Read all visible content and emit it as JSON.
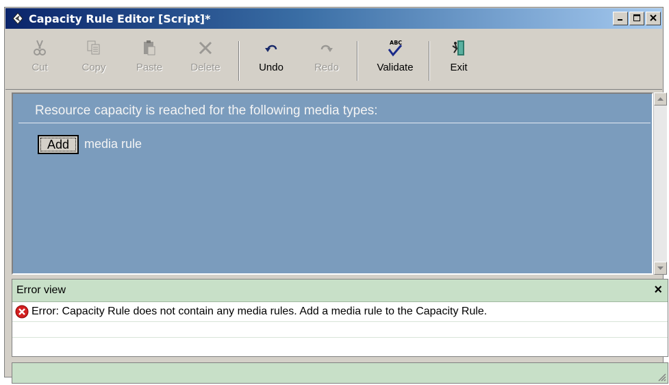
{
  "window": {
    "title": "Capacity Rule Editor [Script]*"
  },
  "toolbar": {
    "cut": "Cut",
    "copy": "Copy",
    "paste": "Paste",
    "delete": "Delete",
    "undo": "Undo",
    "redo": "Redo",
    "validate": "Validate",
    "validate_icon_text": "ABC",
    "exit": "Exit"
  },
  "editor": {
    "heading": "Resource capacity is reached for the following media types:",
    "add_button": "Add",
    "rule_text": "media rule"
  },
  "error_view": {
    "title": "Error view",
    "close": "×",
    "messages": [
      "Error: Capacity Rule does not contain any media rules. Add a media rule to the Capacity Rule."
    ]
  },
  "colors": {
    "editor_bg": "#7b9cbd",
    "panel_header": "#c8e0c8",
    "title_gradient_start": "#0a246a",
    "error_red": "#d32020"
  },
  "icons": [
    "app-logo-icon",
    "minimize-icon",
    "maximize-icon",
    "close-icon",
    "scissors-icon",
    "copy-icon",
    "clipboard-icon",
    "delete-x-icon",
    "undo-arrow-icon",
    "redo-arrow-icon",
    "spellcheck-icon",
    "exit-door-icon",
    "error-icon",
    "resize-grip-icon"
  ]
}
